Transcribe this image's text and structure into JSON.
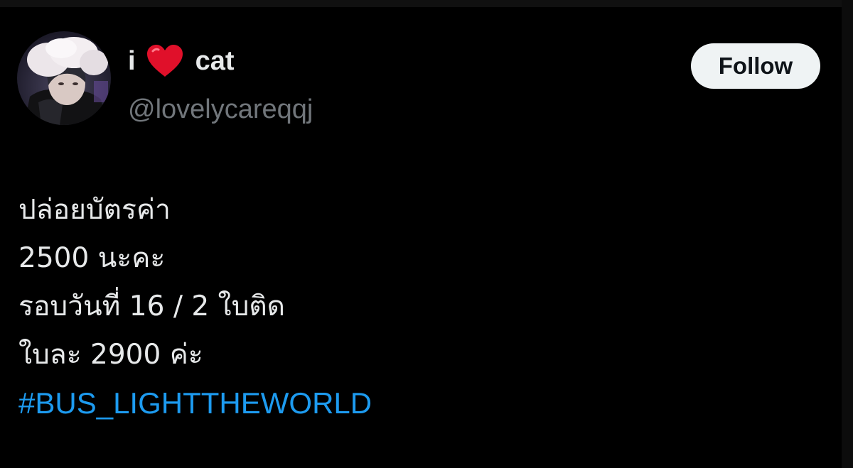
{
  "profile": {
    "display_name_before": "i",
    "display_name_emoji": "heart-emoji",
    "display_name_after": "cat",
    "handle": "@lovelycareqqj",
    "avatar_icon": "user-avatar"
  },
  "actions": {
    "follow_label": "Follow"
  },
  "tweet": {
    "lines": [
      "ปล่อยบัตรค่า",
      "2500 นะคะ",
      "รอบวันที่ 16 / 2 ใบติด",
      "ใบละ 2900 ค่ะ"
    ],
    "hashtag": "#BUS_LIGHTTHEWORLD"
  },
  "colors": {
    "background": "#000000",
    "text_primary": "#e7e9ea",
    "text_secondary": "#71767b",
    "link": "#1d9bf0",
    "button_bg": "#eff3f4",
    "heart": "#e0102a"
  }
}
